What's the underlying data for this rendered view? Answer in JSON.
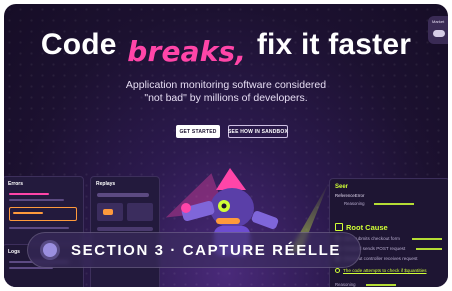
{
  "hero": {
    "title_before": "Code",
    "title_accent": "breaks,",
    "title_after": "fix it faster",
    "subtitle_line1": "Application monitoring software considered",
    "subtitle_line2": "\"not bad\" by millions of developers."
  },
  "cta": {
    "primary": "GET STARTED",
    "secondary": "SEE HOW IN SANDBOX"
  },
  "corner": {
    "label": "Market"
  },
  "panels": {
    "errors": "Errors",
    "replays": "Replays",
    "logs": "Logs"
  },
  "seer": {
    "title": "Seer",
    "error_label": "ReferenceError",
    "reasoning_top": "Reasoning",
    "root_cause": "Root Cause",
    "steps": [
      "User submits checkout form",
      "Frontend sends POST request",
      "Checkout controller receives request"
    ],
    "highlight": "The code attempts to check if $quantities",
    "reasoning_bottom": "Reasoning"
  },
  "caption": {
    "text": "SECTION 3 · CAPTURE RÉELLE"
  },
  "colors": {
    "background": "#1c1130",
    "accent_pink": "#ff45a8",
    "accent_lime": "#d0ff36",
    "panel": "#231a3d"
  }
}
